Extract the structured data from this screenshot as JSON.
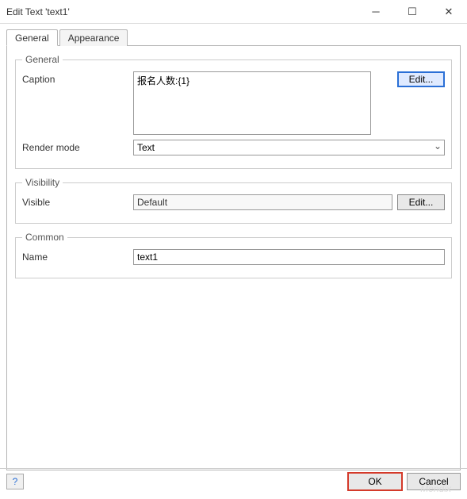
{
  "window": {
    "title": "Edit Text 'text1'"
  },
  "tabs": {
    "general": "General",
    "appearance": "Appearance"
  },
  "groups": {
    "general": {
      "legend": "General",
      "caption_label": "Caption",
      "caption_value": "报名人数:{1}",
      "caption_edit": "Edit...",
      "rendermode_label": "Render mode",
      "rendermode_value": "Text"
    },
    "visibility": {
      "legend": "Visibility",
      "visible_label": "Visible",
      "visible_value": "Default",
      "visible_edit": "Edit..."
    },
    "common": {
      "legend": "Common",
      "name_label": "Name",
      "name_value": "text1"
    }
  },
  "footer": {
    "ok": "OK",
    "cancel": "Cancel",
    "watermark": "Mendix"
  }
}
